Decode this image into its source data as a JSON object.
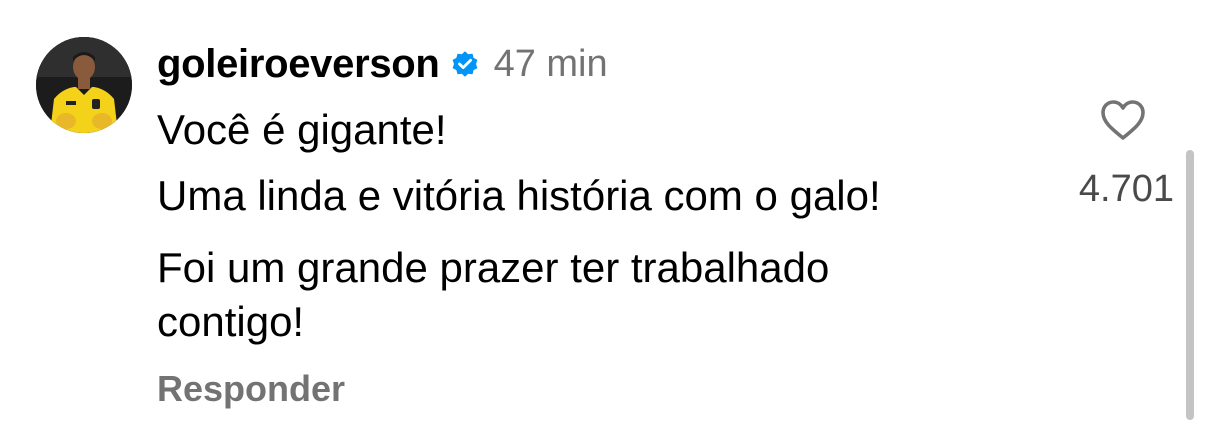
{
  "comment": {
    "username": "goleiroeverson",
    "verified": true,
    "timestamp": "47 min",
    "lines": [
      "Você é gigante!",
      "Uma linda e vitória história com o galo!",
      "Foi um grande prazer ter trabalhado",
      "contigo!"
    ],
    "reply_label": "Responder",
    "like_count": "4.701"
  },
  "icons": {
    "verified": "verified-badge-icon",
    "like": "heart-outline-icon"
  },
  "colors": {
    "verified_blue": "#0095F6",
    "muted_text": "#737373",
    "jersey_yellow": "#F4D21A"
  }
}
